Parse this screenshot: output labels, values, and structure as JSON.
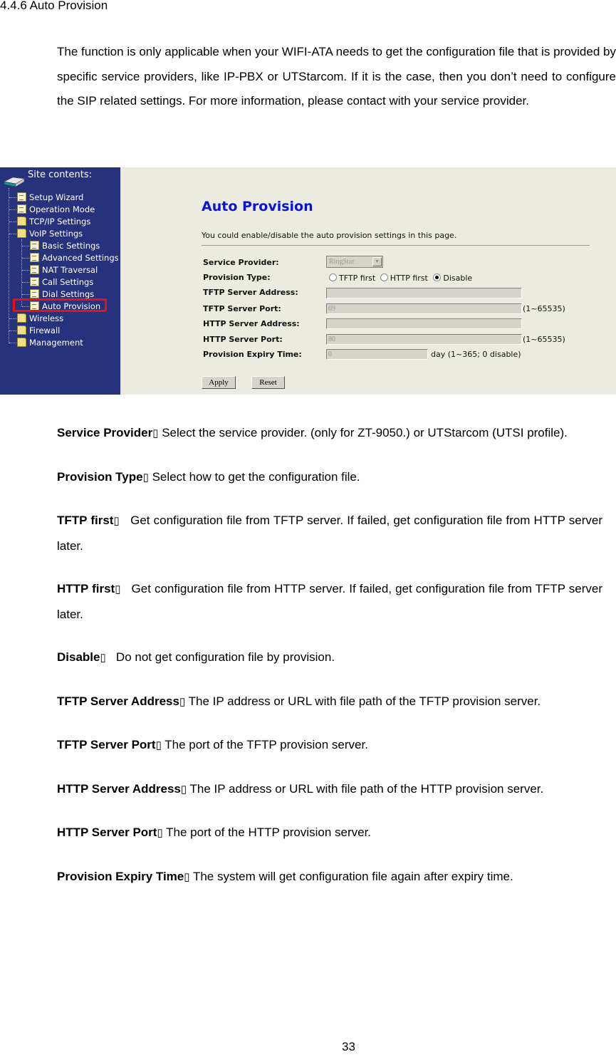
{
  "section_heading": "4.4.6 Auto Provision",
  "intro": "The function is only applicable when your WIFI-ATA needs to get the configuration file that is provided by specific service providers, like IP-PBX or UTStarcom. If it is the case, then you don’t need to configure the SIP related settings. For more information, please contact with your service provider.",
  "screenshot": {
    "sidebar": {
      "title": "Site contents:",
      "items": [
        {
          "label": "Setup Wizard",
          "icon": "document-icon",
          "level": 1
        },
        {
          "label": "Operation Mode",
          "icon": "document-icon",
          "level": 1
        },
        {
          "label": "TCP/IP Settings",
          "icon": "folder-icon",
          "level": 1
        },
        {
          "label": "VoIP Settings",
          "icon": "folder-open-icon",
          "level": 1
        },
        {
          "label": "Basic Settings",
          "icon": "document-icon",
          "level": 2
        },
        {
          "label": "Advanced Settings",
          "icon": "document-icon",
          "level": 2
        },
        {
          "label": "NAT Traversal",
          "icon": "document-icon",
          "level": 2
        },
        {
          "label": "Call Settings",
          "icon": "document-icon",
          "level": 2
        },
        {
          "label": "Dial Settings",
          "icon": "document-icon",
          "level": 2
        },
        {
          "label": "Auto Provision",
          "icon": "document-icon",
          "level": 2,
          "highlighted": true
        },
        {
          "label": "Wireless",
          "icon": "folder-icon",
          "level": 1
        },
        {
          "label": "Firewall",
          "icon": "folder-icon",
          "level": 1
        },
        {
          "label": "Management",
          "icon": "folder-icon",
          "level": 1
        }
      ],
      "highlight_color": "#ee1010",
      "background_color": "#27327c"
    },
    "panel": {
      "title": "Auto Provision",
      "description": "You could enable/disable the auto provision settings in this page.",
      "fields": {
        "service_provider": {
          "label": "Service Provider:",
          "value": "RingStar"
        },
        "provision_type": {
          "label": "Provision Type:",
          "options": [
            "TFTP first",
            "HTTP first",
            "Disable"
          ],
          "selected": "Disable"
        },
        "tftp_server_address": {
          "label": "TFTP Server Address:",
          "value": ""
        },
        "tftp_server_port": {
          "label": "TFTP Server Port:",
          "value": "69",
          "hint": "(1~65535)"
        },
        "http_server_address": {
          "label": "HTTP Server Address:",
          "value": ""
        },
        "http_server_port": {
          "label": "HTTP Server Port:",
          "value": "80",
          "hint": "(1~65535)"
        },
        "provision_expiry_time": {
          "label": "Provision Expiry Time:",
          "value": "0",
          "hint": "day (1~365; 0 disable)"
        }
      },
      "buttons": {
        "apply": "Apply",
        "reset": "Reset"
      },
      "title_color": "#0a14d8"
    }
  },
  "definitions": [
    {
      "term": "Service Provider",
      "sep": "▯",
      "text": " Select the service provider. (only for ZT-9050.) or UTStarcom (UTSI profile)."
    },
    {
      "term": "Provision Type",
      "sep": "▯",
      "text": " Select how to get the configuration file."
    },
    {
      "term": "TFTP first",
      "sep": "▯",
      "text": "   Get configuration file from TFTP server. If failed, get configuration file from HTTP server later."
    },
    {
      "term": "HTTP first",
      "sep": "▯",
      "text": "   Get configuration file from HTTP server. If failed, get configuration file from TFTP server later."
    },
    {
      "term": "Disable",
      "sep": "▯",
      "text": "   Do not get configuration file by provision."
    },
    {
      "term": "TFTP Server Address",
      "sep": "▯",
      "text": " The IP address or URL with file path of the TFTP provision server."
    },
    {
      "term": "TFTP Server Port",
      "sep": "▯",
      "text": " The port of the TFTP provision server."
    },
    {
      "term": "HTTP Server Address",
      "sep": "▯",
      "text": " The IP address or URL with file path of the HTTP provision server."
    },
    {
      "term": "HTTP Server Port",
      "sep": "▯",
      "text": " The port of the HTTP provision server."
    },
    {
      "term": "Provision Expiry Time",
      "sep": "▯",
      "text": " The system will get configuration file again after expiry time."
    }
  ],
  "page_number": "33"
}
